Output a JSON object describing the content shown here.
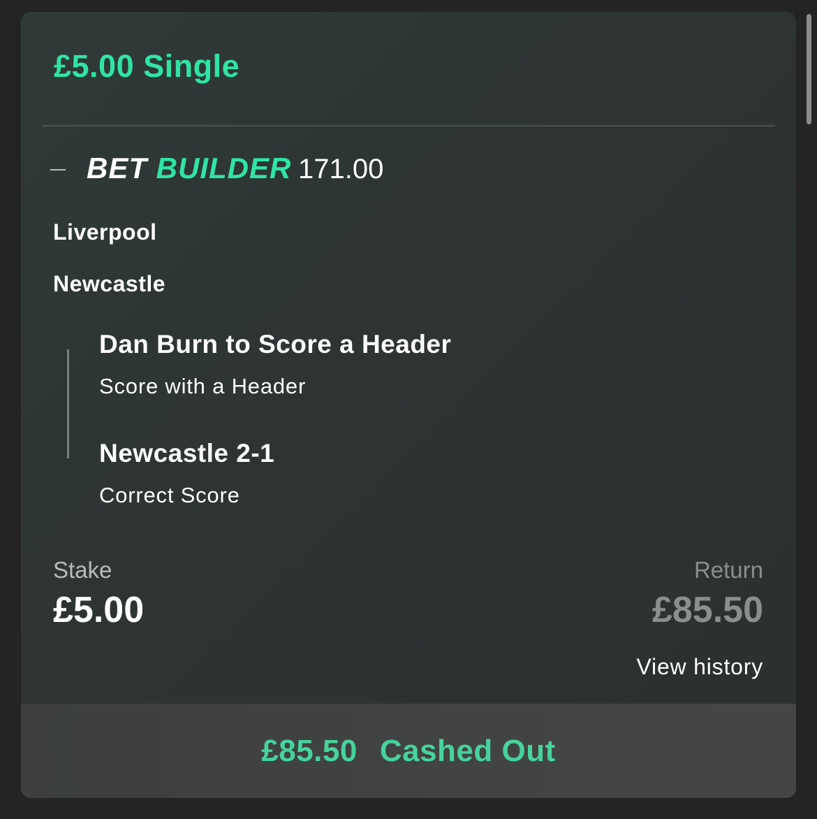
{
  "bet": {
    "title": "£5.00 Single",
    "bet_builder": {
      "logo_bet": "BET",
      "logo_builder": "BUILDER",
      "odds": "171.00"
    },
    "teams": [
      "Liverpool",
      "Newcastle"
    ],
    "selections": [
      {
        "name": "Dan Burn to Score a Header",
        "market": "Score with a Header"
      },
      {
        "name": "Newcastle 2-1",
        "market": "Correct Score"
      }
    ],
    "stake": {
      "label": "Stake",
      "value": "£5.00"
    },
    "return": {
      "label": "Return",
      "value": "£85.50"
    },
    "view_history_label": "View history",
    "cashout": {
      "amount": "£85.50",
      "status": "Cashed Out"
    }
  },
  "colors": {
    "accent": "#2fe5a3",
    "cashout_text": "#46d39d",
    "card_bg": "#2f3433",
    "page_bg": "#242424"
  },
  "icons": {
    "collapse": "minus-icon"
  }
}
